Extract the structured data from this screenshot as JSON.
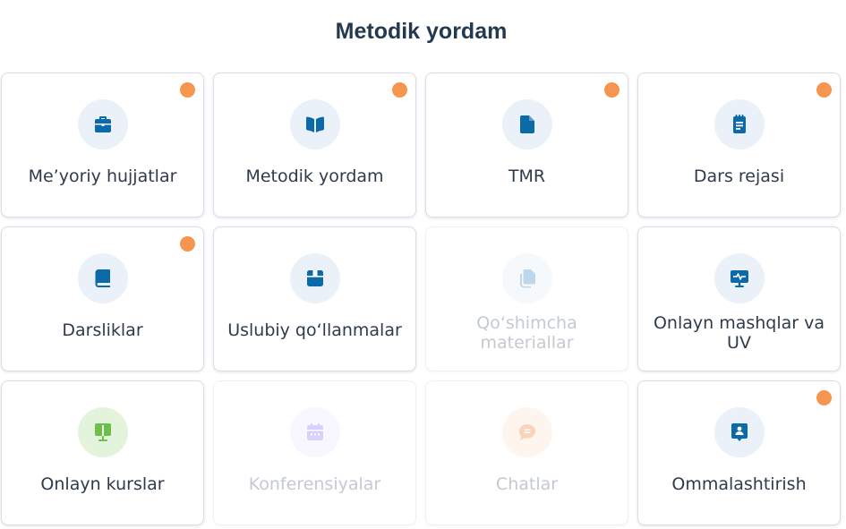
{
  "page_title": "Metodik yordam",
  "colors": {
    "title": "#23394f",
    "text": "#2f3b4c",
    "disabled_text": "#c4cad2",
    "icon_blue": "#0d6aa8",
    "icon_bg": "#eaf1f9",
    "green": "#6cc04a",
    "purple": "#a78bfa",
    "orange_dot": "#f5954f"
  },
  "cards": [
    {
      "label": "Me’yoriy hujjatlar",
      "icon": "briefcase-icon",
      "notification": true,
      "enabled": true
    },
    {
      "label": "Metodik yordam",
      "icon": "book-open-icon",
      "notification": true,
      "enabled": true
    },
    {
      "label": "TMR",
      "icon": "file-icon",
      "notification": true,
      "enabled": true
    },
    {
      "label": "Dars rejasi",
      "icon": "notepad-icon",
      "notification": true,
      "enabled": true
    },
    {
      "label": "Darsliklar",
      "icon": "book-icon",
      "notification": true,
      "enabled": true
    },
    {
      "label": "Uslubiy qo‘llanmalar",
      "icon": "box-icon",
      "notification": false,
      "enabled": true
    },
    {
      "label": "Qo‘shimcha materiallar",
      "icon": "copy-icon",
      "notification": false,
      "enabled": false
    },
    {
      "label": "Onlayn mashqlar va UV",
      "icon": "monitor-pulse-icon",
      "notification": false,
      "enabled": true
    },
    {
      "label": "Onlayn kurslar",
      "icon": "chalkboard-icon",
      "notification": false,
      "enabled": true
    },
    {
      "label": "Konferensiyalar",
      "icon": "calendar-icon",
      "notification": false,
      "enabled": false
    },
    {
      "label": "Chatlar",
      "icon": "chat-icon",
      "notification": false,
      "enabled": false
    },
    {
      "label": "Ommalashtirish",
      "icon": "id-badge-icon",
      "notification": true,
      "enabled": true
    }
  ]
}
